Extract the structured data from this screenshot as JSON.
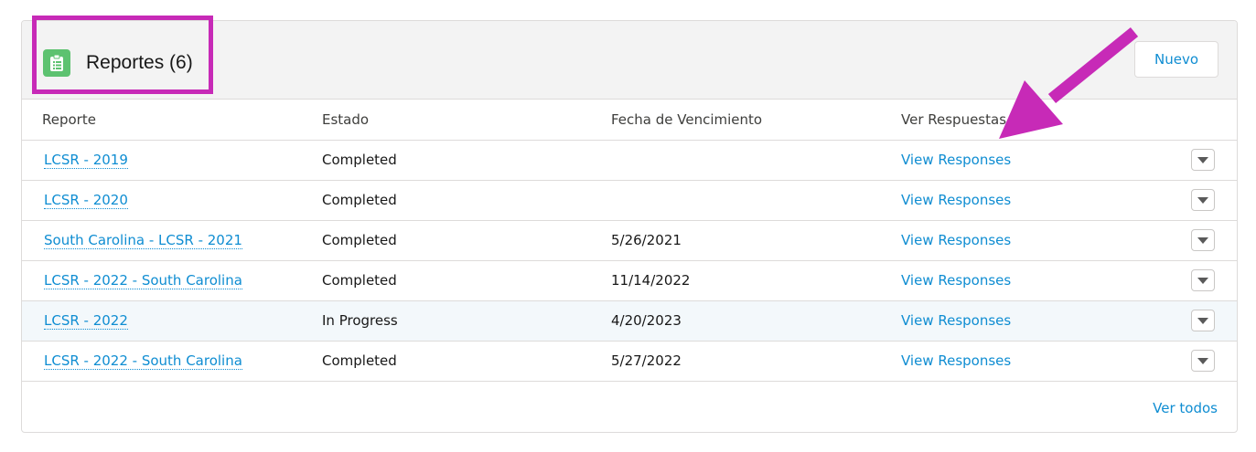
{
  "header": {
    "icon": "clipboard-list-icon",
    "title": "Reportes (6)",
    "new_button_label": "Nuevo",
    "icon_color": "#5dc270"
  },
  "columns": [
    "Reporte",
    "Estado",
    "Fecha de Vencimiento",
    "Ver Respuestas"
  ],
  "rows": [
    {
      "report": "LCSR - 2019",
      "status": "Completed",
      "due_date": "",
      "responses": "View Responses"
    },
    {
      "report": "LCSR - 2020",
      "status": "Completed",
      "due_date": "",
      "responses": "View Responses"
    },
    {
      "report": "South Carolina - LCSR - 2021",
      "status": "Completed",
      "due_date": "5/26/2021",
      "responses": "View Responses"
    },
    {
      "report": "LCSR - 2022 - South Carolina",
      "status": "Completed",
      "due_date": "11/14/2022",
      "responses": "View Responses"
    },
    {
      "report": "LCSR - 2022",
      "status": "In Progress",
      "due_date": "4/20/2023",
      "responses": "View Responses"
    },
    {
      "report": "LCSR - 2022 - South Carolina",
      "status": "Completed",
      "due_date": "5/27/2022",
      "responses": "View Responses"
    }
  ],
  "row_action_icon": "chevron-down-icon",
  "footer": {
    "view_all_label": "Ver todos"
  },
  "annotation": {
    "color": "#c72ab7"
  },
  "colors": {
    "link": "#0f8dd2",
    "hover_row": "#f3f8fb"
  }
}
